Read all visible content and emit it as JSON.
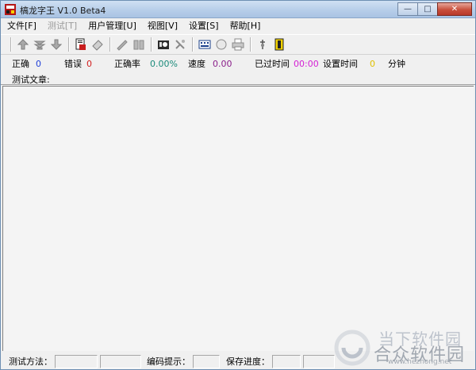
{
  "window": {
    "title": "槁龙字王 V1.0 Beta4",
    "controls": {
      "minimize": "—",
      "maximize": "□",
      "close": "✕"
    }
  },
  "menu": [
    {
      "label": "文件[F]",
      "enabled": true
    },
    {
      "label": "测试[T]",
      "enabled": false
    },
    {
      "label": "用户管理[U]",
      "enabled": true
    },
    {
      "label": "视图[V]",
      "enabled": true
    },
    {
      "label": "设置[S]",
      "enabled": true
    },
    {
      "label": "帮助[H]",
      "enabled": true
    }
  ],
  "toolbar": {
    "buttons": [
      "up-arrow-icon",
      "stack-icon",
      "down-arrow-icon",
      "document-icon",
      "eraser-icon",
      "pen-icon",
      "book-icon",
      "photo-icon",
      "tool-icon",
      "keyboard-icon",
      "record-icon",
      "printer-icon",
      "microphone-icon",
      "exit-door-icon"
    ]
  },
  "stats": {
    "correct_label": "正确",
    "correct_value": "0",
    "error_label": "错误",
    "error_value": "0",
    "accuracy_label": "正确率",
    "accuracy_value": "0.00%",
    "speed_label": "速度",
    "speed_value": "0.00",
    "elapsed_label": "已过时间",
    "elapsed_value": "00:00",
    "set_time_label": "设置时间",
    "set_time_value": "0",
    "minute_label": "分钟",
    "article_label": "测试文章:",
    "colors": {
      "correct": "#1f3fd8",
      "error": "#d21c1c",
      "accuracy": "#1a8a7a",
      "speed": "#8a1f8a",
      "elapsed": "#d41fd4",
      "set_time": "#e0c000"
    }
  },
  "statusbar": {
    "method_label": "测试方法：",
    "hint_label": "编码提示：",
    "progress_label": "保存进度："
  },
  "watermark": {
    "line1": "当下软件园",
    "line2": "合众软件园",
    "url": "www.hezhong.net"
  }
}
